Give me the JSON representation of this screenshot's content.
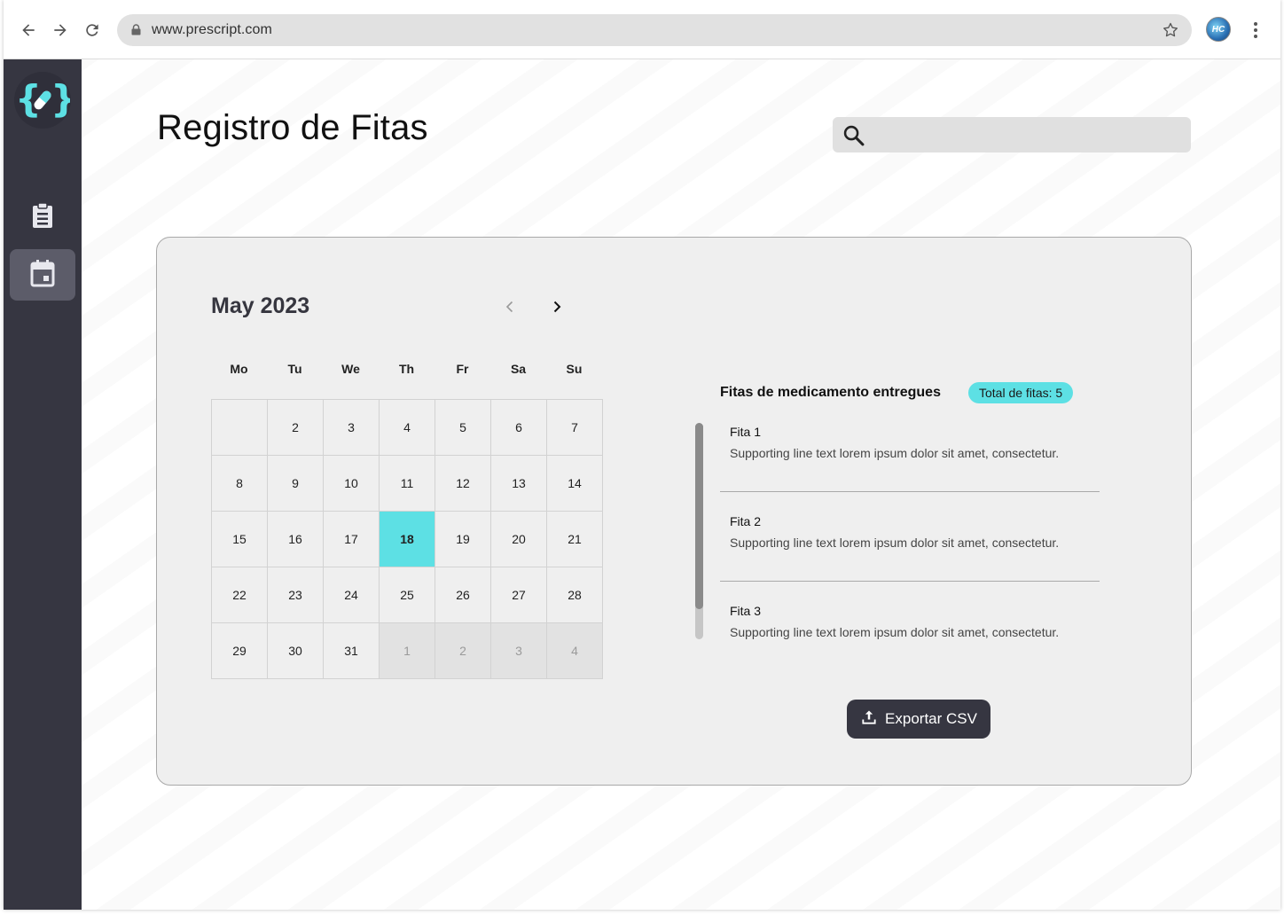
{
  "browser": {
    "url": "www.prescript.com",
    "profile_initials": "HC"
  },
  "sidebar": {
    "items": [
      {
        "name": "clipboard",
        "icon": "clipboard-list-icon"
      },
      {
        "name": "calendar",
        "icon": "calendar-icon",
        "active": true
      }
    ]
  },
  "page": {
    "title": "Registro de Fitas",
    "search_placeholder": ""
  },
  "calendar": {
    "month_label": "May 2023",
    "weekdays": [
      "Mo",
      "Tu",
      "We",
      "Th",
      "Fr",
      "Sa",
      "Su"
    ],
    "weeks": [
      [
        "",
        "2",
        "3",
        "4",
        "5",
        "6",
        "7"
      ],
      [
        "8",
        "9",
        "10",
        "11",
        "12",
        "13",
        "14"
      ],
      [
        "15",
        "16",
        "17",
        "18",
        "19",
        "20",
        "21"
      ],
      [
        "22",
        "23",
        "24",
        "25",
        "26",
        "27",
        "28"
      ],
      [
        "29",
        "30",
        "31",
        "1",
        "2",
        "3",
        "4"
      ]
    ],
    "selected_day": "18",
    "next_month_days_from_index": 31
  },
  "list": {
    "title": "Fitas de medicamento entregues",
    "badge": "Total de fitas: 5",
    "items": [
      {
        "name": "Fita 1",
        "desc": "Supporting line text lorem ipsum dolor sit amet, consectetur."
      },
      {
        "name": "Fita 2",
        "desc": "Supporting line text lorem ipsum dolor sit amet, consectetur."
      },
      {
        "name": "Fita 3",
        "desc": "Supporting line text lorem ipsum dolor sit amet, consectetur."
      }
    ]
  },
  "actions": {
    "export_label": "Exportar CSV"
  },
  "colors": {
    "sidebar": "#363641",
    "accent": "#5de0e4",
    "card": "#efefef"
  }
}
